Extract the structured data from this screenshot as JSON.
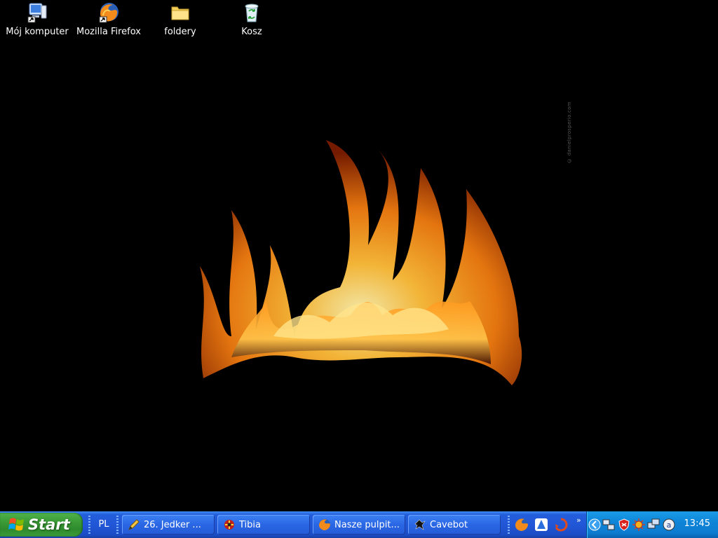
{
  "desktop": {
    "icons": [
      {
        "label": "Mój komputer",
        "icon": "my-computer-icon"
      },
      {
        "label": "Mozilla Firefox",
        "icon": "firefox-icon"
      },
      {
        "label": "foldery",
        "icon": "folder-icon"
      },
      {
        "label": "Kosz",
        "icon": "recycle-bin-icon"
      }
    ],
    "watermark": "© danielprosperio.com",
    "wallpaper": "fire-flames"
  },
  "taskbar": {
    "start_label": "Start",
    "language": "PL",
    "tasks": [
      {
        "label": "26. Jedker ...",
        "icon": "pencil-app-icon"
      },
      {
        "label": "Tibia",
        "icon": "tibia-icon"
      },
      {
        "label": "Nasze pulpit...",
        "icon": "firefox-icon"
      },
      {
        "label": "Cavebot",
        "icon": "cavebot-icon"
      }
    ],
    "quick_launch": [
      "firefox-icon",
      "messenger-icon",
      "browser-icon"
    ],
    "overflow": "»",
    "tray_icons": [
      "show-hidden-icon",
      "network-icon",
      "shield-icon",
      "sun-icon",
      "monitors-icon",
      "a-icon"
    ],
    "clock": "13:45"
  },
  "colors": {
    "taskbar": "#245edb",
    "start": "#3a9a35",
    "tray": "#0f85d8"
  }
}
